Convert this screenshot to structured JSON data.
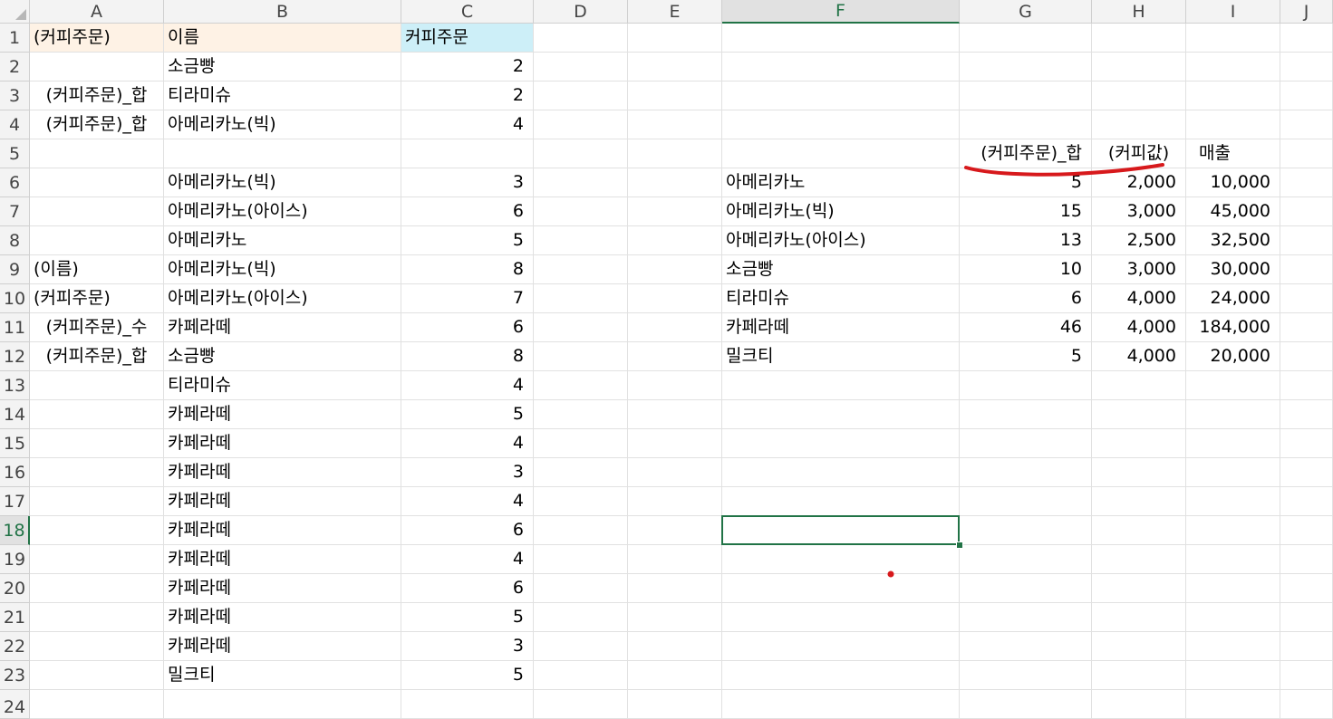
{
  "columns": [
    "A",
    "B",
    "C",
    "D",
    "E",
    "F",
    "G",
    "H",
    "I",
    "J"
  ],
  "rows": [
    "1",
    "2",
    "3",
    "4",
    "5",
    "6",
    "7",
    "8",
    "9",
    "10",
    "11",
    "12",
    "13",
    "14",
    "15",
    "16",
    "17",
    "18",
    "19",
    "20",
    "21",
    "22",
    "23"
  ],
  "partial_row_label": "24",
  "selected": {
    "column": "F",
    "row": "18"
  },
  "colors": {
    "accent": "#217346",
    "peach_fill": "#fef2e5",
    "cyan_fill": "#cdeff8",
    "annotation": "#d7191c"
  },
  "cells": [
    {
      "ref": "A1",
      "value": "(커피주문)",
      "fill": "peach"
    },
    {
      "ref": "B1",
      "value": "이름",
      "fill": "peach"
    },
    {
      "ref": "C1",
      "value": "커피주문",
      "fill": "cyan"
    },
    {
      "ref": "B2",
      "value": "소금빵"
    },
    {
      "ref": "C2",
      "value": "2",
      "align": "num"
    },
    {
      "ref": "A3",
      "value": "(커피주문)_합",
      "align": "ctr"
    },
    {
      "ref": "B3",
      "value": "티라미슈"
    },
    {
      "ref": "C3",
      "value": "2",
      "align": "num"
    },
    {
      "ref": "A4",
      "value": "(커피주문)_합",
      "align": "ctr"
    },
    {
      "ref": "B4",
      "value": "아메리카노(빅)"
    },
    {
      "ref": "C4",
      "value": "4",
      "align": "num"
    },
    {
      "ref": "B6",
      "value": "아메리카노(빅)"
    },
    {
      "ref": "C6",
      "value": "3",
      "align": "num"
    },
    {
      "ref": "B7",
      "value": "아메리카노(아이스)"
    },
    {
      "ref": "C7",
      "value": "6",
      "align": "num"
    },
    {
      "ref": "B8",
      "value": "아메리카노"
    },
    {
      "ref": "C8",
      "value": "5",
      "align": "num"
    },
    {
      "ref": "A9",
      "value": "(이름)"
    },
    {
      "ref": "B9",
      "value": "아메리카노(빅)"
    },
    {
      "ref": "C9",
      "value": "8",
      "align": "num"
    },
    {
      "ref": "A10",
      "value": "(커피주문)"
    },
    {
      "ref": "B10",
      "value": "아메리카노(아이스)"
    },
    {
      "ref": "C10",
      "value": "7",
      "align": "num"
    },
    {
      "ref": "A11",
      "value": "(커피주문)_수",
      "align": "ctr"
    },
    {
      "ref": "B11",
      "value": "카페라떼"
    },
    {
      "ref": "C11",
      "value": "6",
      "align": "num"
    },
    {
      "ref": "A12",
      "value": "(커피주문)_합",
      "align": "ctr"
    },
    {
      "ref": "B12",
      "value": "소금빵"
    },
    {
      "ref": "C12",
      "value": "8",
      "align": "num"
    },
    {
      "ref": "B13",
      "value": "티라미슈"
    },
    {
      "ref": "C13",
      "value": "4",
      "align": "num"
    },
    {
      "ref": "B14",
      "value": "카페라떼"
    },
    {
      "ref": "C14",
      "value": "5",
      "align": "num"
    },
    {
      "ref": "B15",
      "value": "카페라떼"
    },
    {
      "ref": "C15",
      "value": "4",
      "align": "num"
    },
    {
      "ref": "B16",
      "value": "카페라떼"
    },
    {
      "ref": "C16",
      "value": "3",
      "align": "num"
    },
    {
      "ref": "B17",
      "value": "카페라떼"
    },
    {
      "ref": "C17",
      "value": "4",
      "align": "num"
    },
    {
      "ref": "B18",
      "value": "카페라떼"
    },
    {
      "ref": "C18",
      "value": "6",
      "align": "num"
    },
    {
      "ref": "B19",
      "value": "카페라떼"
    },
    {
      "ref": "C19",
      "value": "4",
      "align": "num"
    },
    {
      "ref": "B20",
      "value": "카페라떼"
    },
    {
      "ref": "C20",
      "value": "6",
      "align": "num"
    },
    {
      "ref": "B21",
      "value": "카페라떼"
    },
    {
      "ref": "C21",
      "value": "5",
      "align": "num"
    },
    {
      "ref": "B22",
      "value": "카페라떼"
    },
    {
      "ref": "C22",
      "value": "3",
      "align": "num"
    },
    {
      "ref": "B23",
      "value": "밀크티"
    },
    {
      "ref": "C23",
      "value": "5",
      "align": "num"
    },
    {
      "ref": "G5",
      "value": "(커피주문)_합",
      "align": "num"
    },
    {
      "ref": "H5",
      "value": "(커피값)",
      "align": "ctr"
    },
    {
      "ref": "I5",
      "value": "매출",
      "align": "left-pad"
    },
    {
      "ref": "F6",
      "value": "아메리카노"
    },
    {
      "ref": "G6",
      "value": "5",
      "align": "num"
    },
    {
      "ref": "H6",
      "value": "2,000",
      "align": "num"
    },
    {
      "ref": "I6",
      "value": "10,000",
      "align": "num"
    },
    {
      "ref": "F7",
      "value": "아메리카노(빅)"
    },
    {
      "ref": "G7",
      "value": "15",
      "align": "num"
    },
    {
      "ref": "H7",
      "value": "3,000",
      "align": "num"
    },
    {
      "ref": "I7",
      "value": "45,000",
      "align": "num"
    },
    {
      "ref": "F8",
      "value": "아메리카노(아이스)"
    },
    {
      "ref": "G8",
      "value": "13",
      "align": "num"
    },
    {
      "ref": "H8",
      "value": "2,500",
      "align": "num"
    },
    {
      "ref": "I8",
      "value": "32,500",
      "align": "num"
    },
    {
      "ref": "F9",
      "value": "소금빵"
    },
    {
      "ref": "G9",
      "value": "10",
      "align": "num"
    },
    {
      "ref": "H9",
      "value": "3,000",
      "align": "num"
    },
    {
      "ref": "I9",
      "value": "30,000",
      "align": "num"
    },
    {
      "ref": "F10",
      "value": "티라미슈"
    },
    {
      "ref": "G10",
      "value": "6",
      "align": "num"
    },
    {
      "ref": "H10",
      "value": "4,000",
      "align": "num"
    },
    {
      "ref": "I10",
      "value": "24,000",
      "align": "num"
    },
    {
      "ref": "F11",
      "value": "카페라떼"
    },
    {
      "ref": "G11",
      "value": "46",
      "align": "num"
    },
    {
      "ref": "H11",
      "value": "4,000",
      "align": "num"
    },
    {
      "ref": "I11",
      "value": "184,000",
      "align": "num"
    },
    {
      "ref": "F12",
      "value": "밀크티"
    },
    {
      "ref": "G12",
      "value": "5",
      "align": "num"
    },
    {
      "ref": "H12",
      "value": "4,000",
      "align": "num"
    },
    {
      "ref": "I12",
      "value": "20,000",
      "align": "num"
    }
  ]
}
